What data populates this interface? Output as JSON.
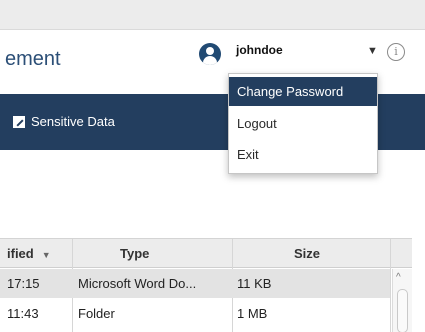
{
  "header": {
    "title": "ement",
    "username": "johndoe",
    "caret": "▼",
    "info": "i"
  },
  "navbar": {
    "items": [
      {
        "label": "Sensitive Data"
      }
    ]
  },
  "user_menu": {
    "items": [
      {
        "label": "Change Password",
        "active": true
      },
      {
        "label": "Logout"
      },
      {
        "label": "Exit"
      }
    ]
  },
  "table": {
    "columns": [
      {
        "label": "ified",
        "sort": "▼"
      },
      {
        "label": "Type"
      },
      {
        "label": "Size"
      }
    ],
    "rows": [
      {
        "modified": "17:15",
        "type": "Microsoft Word Do...",
        "size": "11 KB",
        "selected": true
      },
      {
        "modified": "11:43",
        "type": "Folder",
        "size": "1 MB",
        "selected": false
      }
    ]
  },
  "scrollbar": {
    "up_arrow": "^"
  },
  "colors": {
    "accent": "#233e5f",
    "title": "#2c4f77",
    "selected_row": "#e3e3e3"
  }
}
